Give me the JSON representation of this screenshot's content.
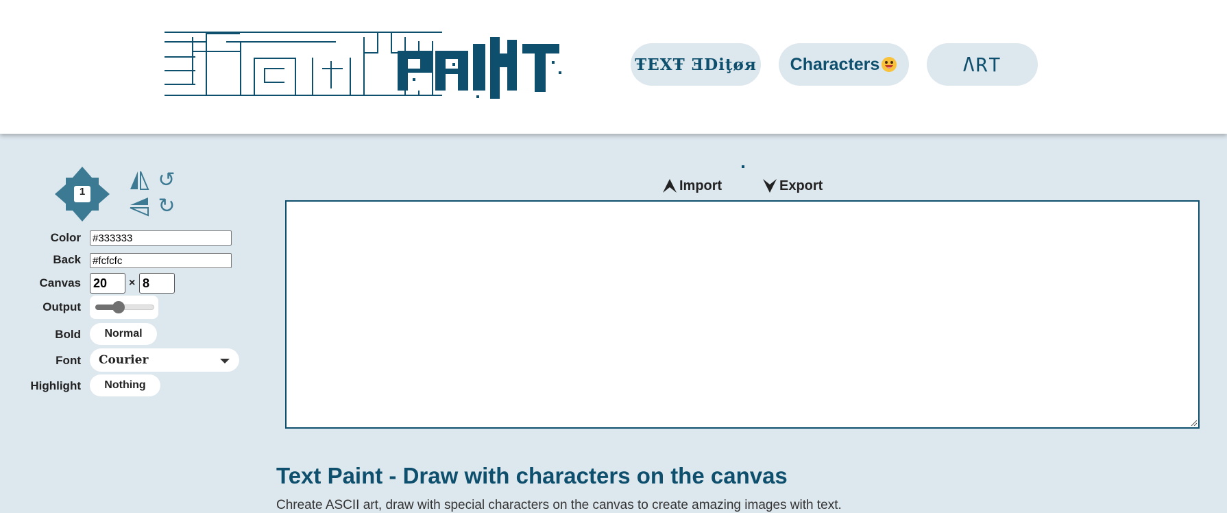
{
  "header": {
    "logo_text": "TextPAINT",
    "nav": {
      "text_editor_label": "ŦEXŦ ƎDiţøя",
      "characters_label": "Characters",
      "art_label": "ΛRT"
    }
  },
  "toolbar": {
    "brush_size": "1",
    "color_label": "Color",
    "color_value": "#333333",
    "back_label": "Back",
    "back_value": "#fcfcfc",
    "canvas_label": "Canvas",
    "canvas_width": "20",
    "canvas_times": "×",
    "canvas_height": "8",
    "output_label": "Output",
    "output_slider_fraction": 0.4,
    "bold_label": "Bold",
    "bold_value": "Normal",
    "font_label": "Font",
    "font_value": "Courier",
    "highlight_label": "Highlight",
    "highlight_value": "Nothing"
  },
  "io": {
    "import_label": "Import",
    "export_label": "Export"
  },
  "content": {
    "title": "Text Paint - Draw with characters on the canvas",
    "description": "Chreate ASCII art, draw with special characters on the canvas to create amazing images with text."
  },
  "colors": {
    "brand": "#0d4f6c",
    "accent": "#3b7a92",
    "background": "#dde7ee"
  },
  "icons": [
    "dpad-arrows-icon",
    "flip-horizontal-icon",
    "flip-vertical-icon",
    "rotate-ccw-icon",
    "rotate-cw-icon",
    "import-arrow-icon",
    "export-arrow-icon",
    "smiley-emoji-icon",
    "chevron-down-icon"
  ]
}
